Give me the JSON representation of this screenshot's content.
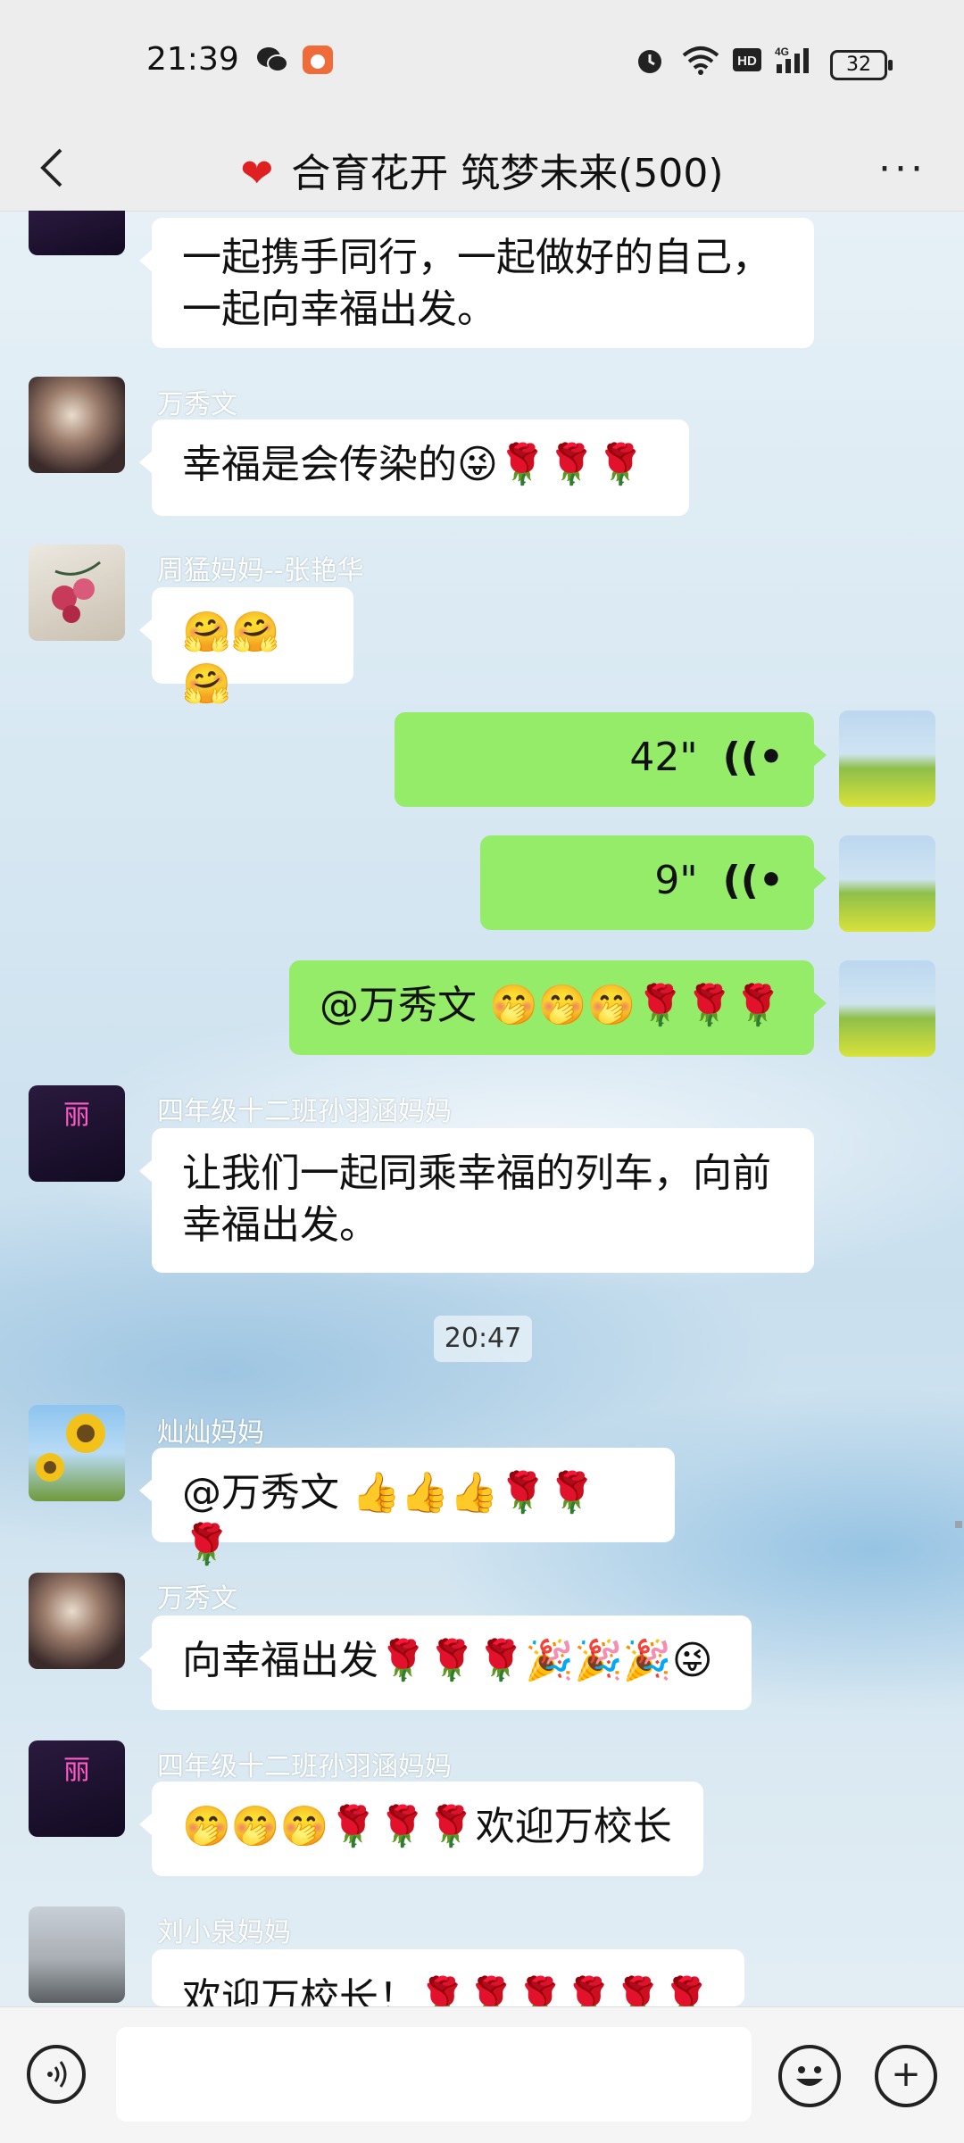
{
  "status_bar": {
    "time": "21:39",
    "battery": "32",
    "icons": [
      "wechat-icon",
      "app-notification-icon",
      "alarm-icon",
      "wifi-icon",
      "hd-icon",
      "signal-4g-icon"
    ]
  },
  "nav": {
    "title": "合育花开 筑梦未来(500)",
    "title_icon": "heart-icon",
    "more_label": "···"
  },
  "messages": [
    {
      "sender": "",
      "text": "一起携手同行，一起做好的自己，\n一起向幸福出发。",
      "side": "left"
    },
    {
      "sender": "万秀文",
      "text": "幸福是会传染的😜🌹🌹🌹",
      "side": "left"
    },
    {
      "sender": "周猛妈妈--张艳华",
      "text": "🤗🤗🤗",
      "side": "left"
    },
    {
      "sender": "",
      "voice_duration": "42\"",
      "side": "right"
    },
    {
      "sender": "",
      "voice_duration": "9\"",
      "side": "right"
    },
    {
      "sender": "",
      "text": "@万秀文 🤭🤭🤭🌹🌹🌹",
      "side": "right"
    },
    {
      "sender": "四年级十二班孙羽涵妈妈",
      "text": "让我们一起同乘幸福的列车，向前\n幸福出发。",
      "side": "left"
    },
    {
      "sender": "灿灿妈妈",
      "text": "@万秀文 👍👍👍🌹🌹🌹",
      "side": "left"
    },
    {
      "sender": "万秀文",
      "text": "向幸福出发🌹🌹🌹🎉🎉🎉😜",
      "side": "left"
    },
    {
      "sender": "四年级十二班孙羽涵妈妈",
      "text": "🤭🤭🤭🌹🌹🌹欢迎万校长",
      "side": "left"
    },
    {
      "sender": "刘小泉妈妈",
      "text": "欢迎万校长！🌹🌹🌹🌹🌹🌹",
      "side": "left"
    }
  ],
  "timestamp": "20:47",
  "avatar_neon_text": "丽",
  "input": {
    "placeholder": "",
    "voice_icon": "voice-input-icon",
    "emoji_icon": "emoji-icon",
    "plus_icon": "plus-icon",
    "plus_label": "+"
  },
  "colors": {
    "my_bubble": "#95ec69",
    "other_bubble": "#ffffff",
    "bar_bg": "#ededed"
  }
}
